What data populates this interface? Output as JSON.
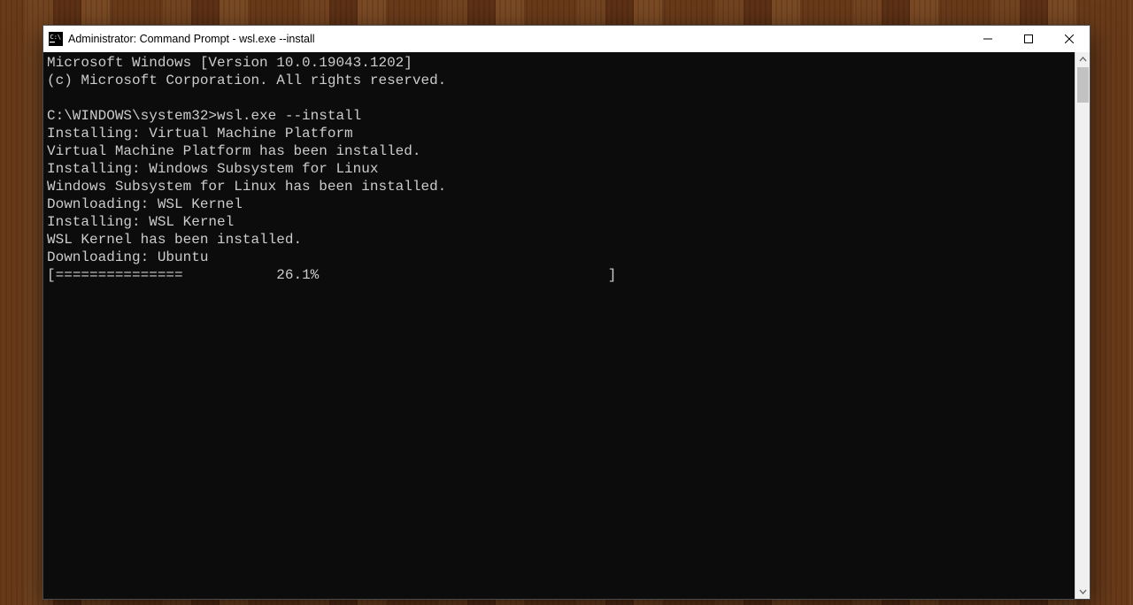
{
  "window": {
    "title": "Administrator: Command Prompt - wsl.exe  --install"
  },
  "terminal": {
    "version_line": "Microsoft Windows [Version 10.0.19043.1202]",
    "copyright_line": "(c) Microsoft Corporation. All rights reserved.",
    "prompt": "C:\\WINDOWS\\system32>",
    "command": "wsl.exe --install",
    "lines": {
      "l1": "Installing: Virtual Machine Platform",
      "l2": "Virtual Machine Platform has been installed.",
      "l3": "Installing: Windows Subsystem for Linux",
      "l4": "Windows Subsystem for Linux has been installed.",
      "l5": "Downloading: WSL Kernel",
      "l6": "Installing: WSL Kernel",
      "l7": "WSL Kernel has been installed.",
      "l8": "Downloading: Ubuntu"
    },
    "progress": {
      "bar_prefix": "[",
      "bar_fill": "===============",
      "bar_gap": "           ",
      "percent": "26.1%",
      "bar_rest": "                                  ",
      "bar_suffix": "]"
    }
  }
}
